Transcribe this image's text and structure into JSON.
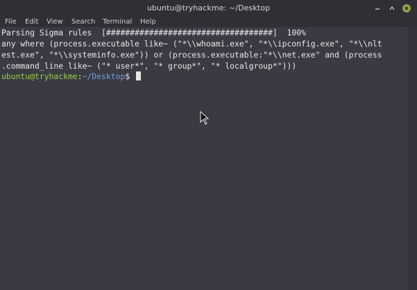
{
  "window": {
    "title": "ubuntu@tryhackme: ~/Desktop"
  },
  "menubar": {
    "items": [
      "File",
      "Edit",
      "View",
      "Search",
      "Terminal",
      "Help"
    ]
  },
  "terminal": {
    "lines": [
      "Parsing Sigma rules  [###################################]  100%",
      "any where (process.executable like~ (\"*\\\\whoami.exe\", \"*\\\\ipconfig.exe\", \"*\\\\nlt",
      "est.exe\", \"*\\\\systeminfo.exe\")) or (process.executable:\"*\\\\net.exe\" and (process",
      ".command_line like~ (\"* user*\", \"* group*\", \"* localgroup*\")))"
    ],
    "prompt": {
      "user_host": "ubuntu@tryhackme",
      "separator": ":",
      "path": "~/Desktop",
      "symbol": "$ "
    }
  },
  "icons": {
    "minimize": "minimize-icon",
    "maximize": "maximize-icon",
    "close": "close-icon",
    "pointer": "mouse-pointer-icon"
  },
  "colors": {
    "background": "#3a3b42",
    "titlebar": "#2f3035",
    "prompt_user": "#9acb4b",
    "prompt_path": "#6f9fd8",
    "text": "#e8e8e8"
  }
}
